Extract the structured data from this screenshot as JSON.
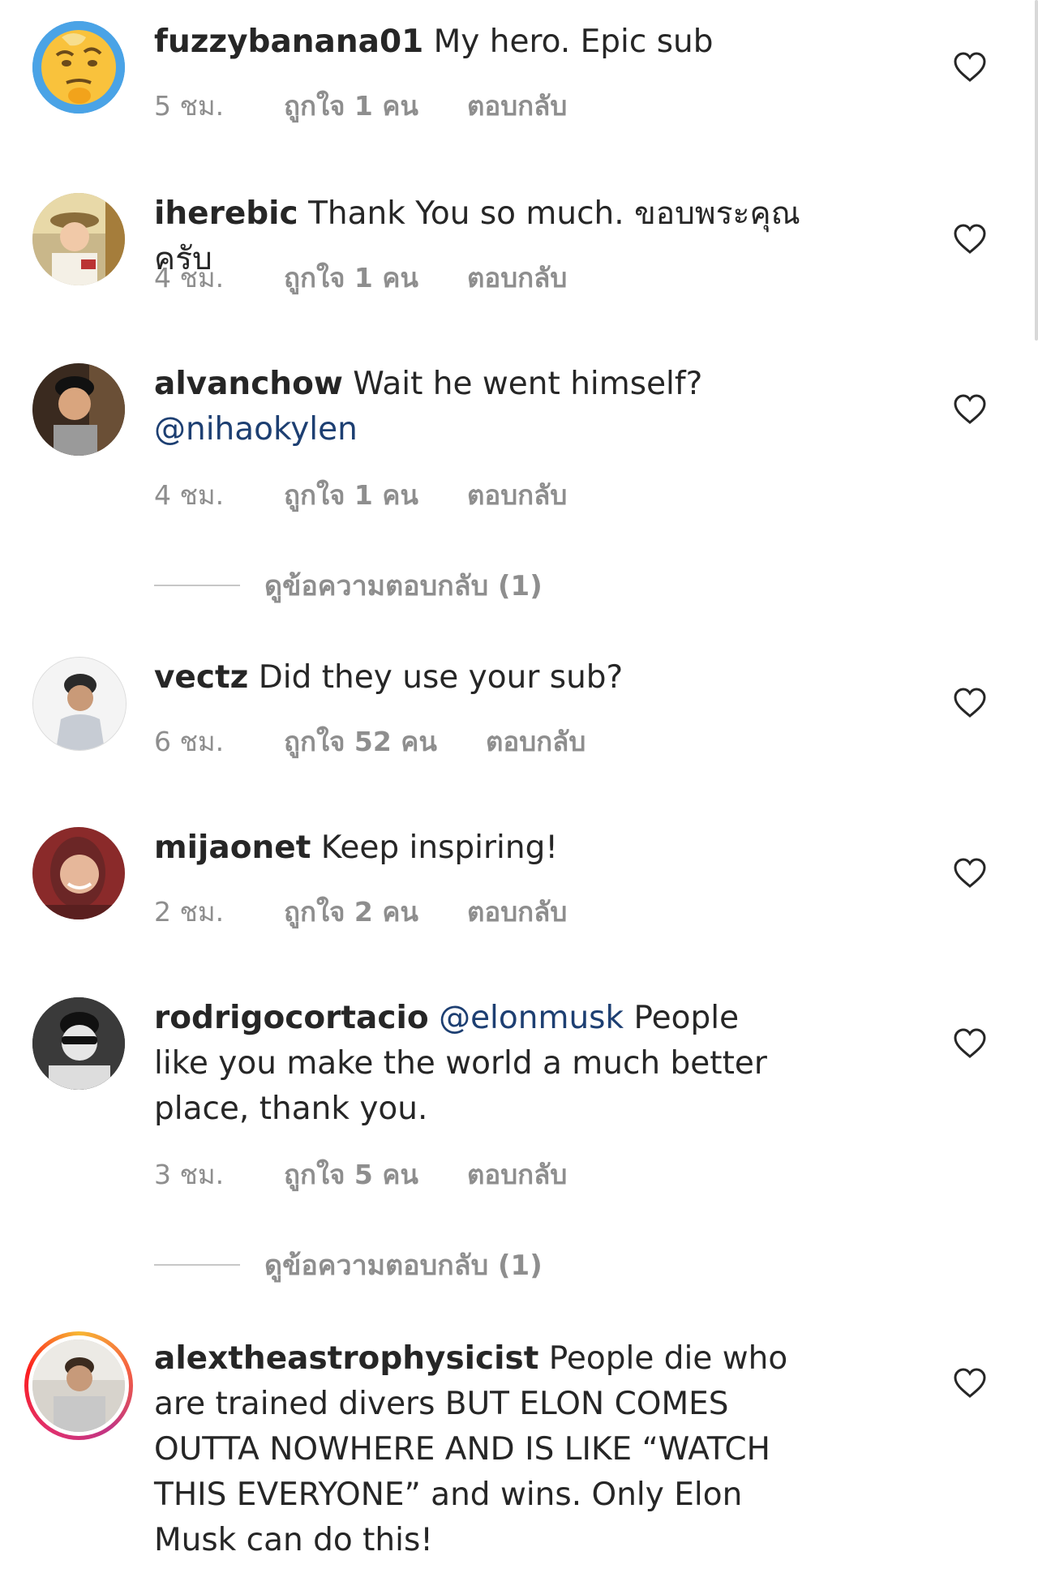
{
  "comments": [
    {
      "username": "fuzzybanana01",
      "text": " My hero. Epic sub",
      "time": "5 ชม.",
      "likes": "ถูกใจ 1 คน",
      "reply": "ตอบกลับ",
      "avatar_icon": "thinking-emoji-avatar"
    },
    {
      "username": "iherebic",
      "text": " Thank You so much. ขอบพระคุณครับ",
      "time": "4 ชม.",
      "likes": "ถูกใจ 1 คน",
      "reply": "ตอบกลับ",
      "avatar_icon": "user-photo-avatar"
    },
    {
      "username": "alvanchow",
      "text": " Wait he went himself?",
      "mention": "@nihaokylen",
      "time": "4 ชม.",
      "likes": "ถูกใจ 1 คน",
      "reply": "ตอบกลับ",
      "view_replies": "ดูข้อความตอบกลับ (1)",
      "avatar_icon": "user-photo-avatar"
    },
    {
      "username": "vectz",
      "text": " Did they use your sub?",
      "time": "6 ชม.",
      "likes": "ถูกใจ 52 คน",
      "reply": "ตอบกลับ",
      "avatar_icon": "user-photo-avatar"
    },
    {
      "username": "mijaonet",
      "text": " Keep inspiring!",
      "time": "2 ชม.",
      "likes": "ถูกใจ 2 คน",
      "reply": "ตอบกลับ",
      "avatar_icon": "user-photo-avatar"
    },
    {
      "username": "rodrigocortacio",
      "mention": "@elonmusk",
      "text": " People like you make the world a much better place, thank you.",
      "time": "3 ชม.",
      "likes": "ถูกใจ 5 คน",
      "reply": "ตอบกลับ",
      "view_replies": "ดูข้อความตอบกลับ (1)",
      "avatar_icon": "user-photo-avatar"
    },
    {
      "username": "alextheastrophysicist",
      "text": " People die who are trained divers BUT ELON COMES OUTTA NOWHERE AND IS LIKE “WATCH THIS EVERYONE” and wins. Only Elon Musk can do this!",
      "avatar_icon": "story-ring-user-avatar"
    }
  ],
  "colors": {
    "text": "#262626",
    "meta": "#8e8e8e",
    "mention": "#1d3f72"
  },
  "icons": {
    "like": "heart-outline-icon"
  }
}
